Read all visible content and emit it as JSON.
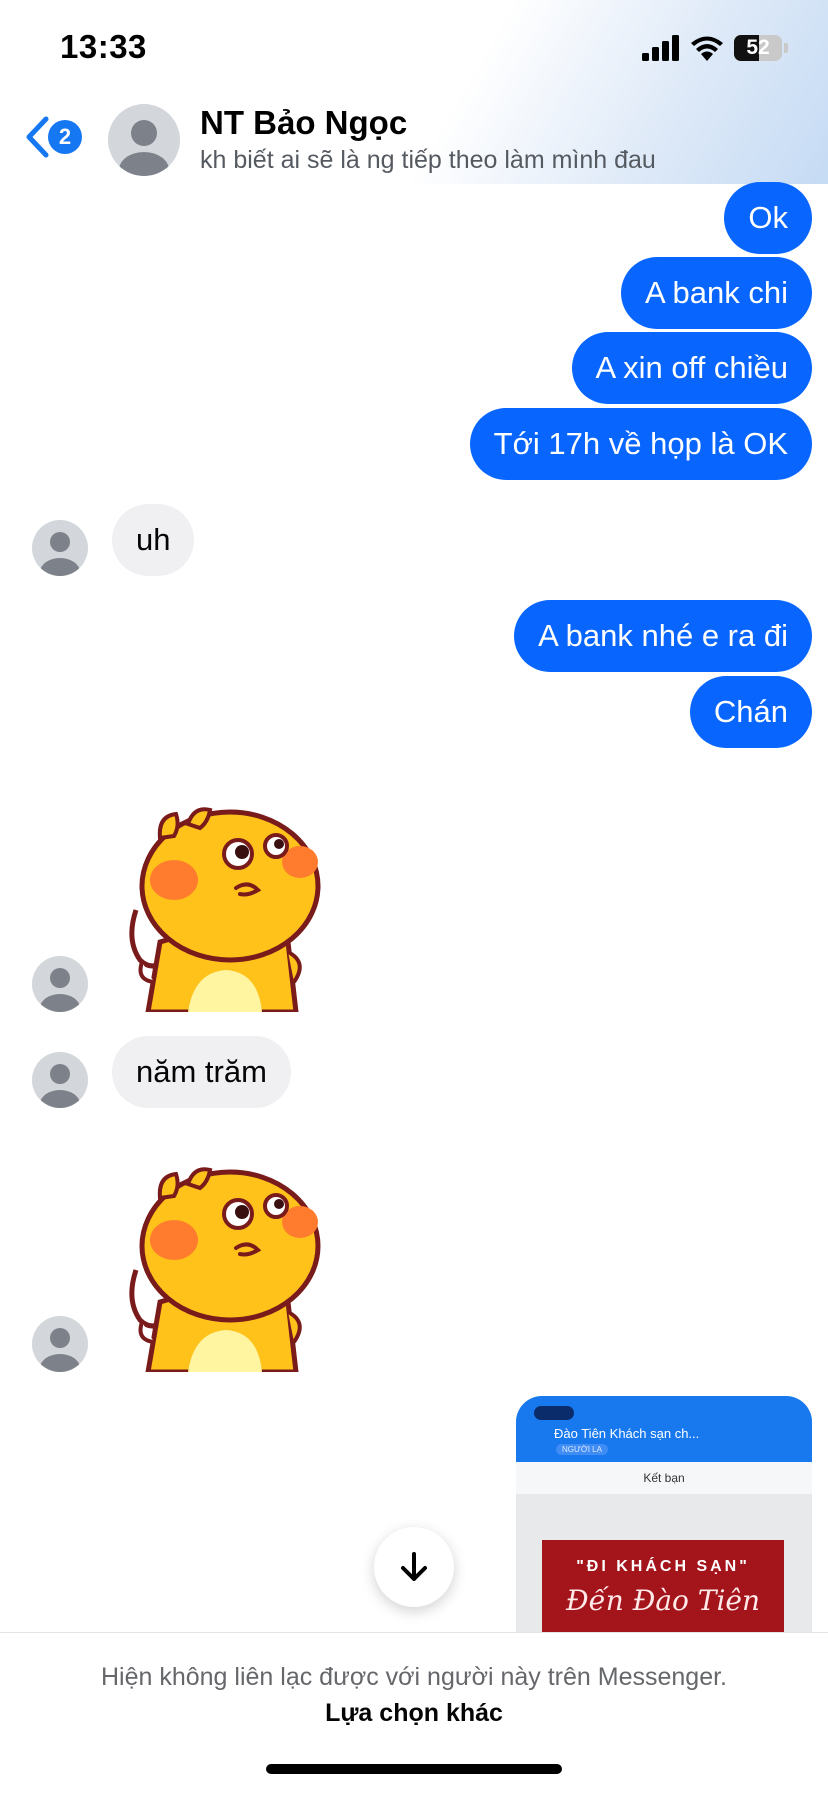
{
  "status_bar": {
    "time": "13:33",
    "battery": "52"
  },
  "header": {
    "back_badge": "2",
    "contact_name": "NT Bảo Ngọc",
    "contact_status": "kh biết ai sẽ là ng tiếp theo làm mình đau"
  },
  "messages": [
    {
      "from": "me",
      "text": "Ok"
    },
    {
      "from": "me",
      "text": "A bank chi"
    },
    {
      "from": "me",
      "text": "A xin off chiều"
    },
    {
      "from": "me",
      "text": "Tới 17h về họp là OK"
    },
    {
      "from": "them",
      "text": "uh"
    },
    {
      "from": "me",
      "text": "A bank nhé e ra đi"
    },
    {
      "from": "me",
      "text": "Chán"
    },
    {
      "from": "them",
      "type": "sticker",
      "icon": "yellow-duck-sticker"
    },
    {
      "from": "them",
      "text": "năm trăm"
    },
    {
      "from": "them",
      "type": "sticker",
      "icon": "yellow-duck-sticker"
    },
    {
      "from": "me",
      "type": "image"
    }
  ],
  "attachment": {
    "title": "Đào Tiên Khách sạn ch...",
    "subtitle": "NGƯỜI LẠ",
    "add_friend": "Kết bạn",
    "banner_line1": "\"ĐI KHÁCH SẠN\"",
    "banner_line2": "Đến Đào Tiên"
  },
  "footer": {
    "message": "Hiện không liên lạc được với người này trên Messenger.",
    "link": "Lựa chọn khác"
  },
  "colors": {
    "accent": "#0866ff",
    "incoming_bubble": "#f0f0f2"
  }
}
